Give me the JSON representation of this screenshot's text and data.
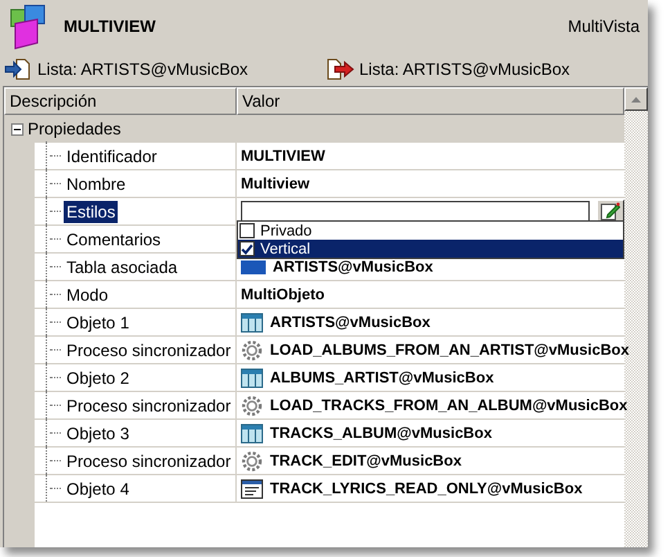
{
  "header": {
    "title": "MULTIVIEW",
    "type_label": "MultiVista"
  },
  "links": [
    {
      "kind": "in",
      "label": "Lista: ARTISTS@vMusicBox"
    },
    {
      "kind": "out",
      "label": "Lista: ARTISTS@vMusicBox"
    }
  ],
  "grid": {
    "columns": [
      "Descripción",
      "Valor"
    ],
    "group": {
      "label": "Propiedades",
      "expanded": true,
      "rows": [
        {
          "label": "Identificador",
          "kind": "text",
          "value": "MULTIVIEW",
          "selected": false
        },
        {
          "label": "Nombre",
          "kind": "text",
          "value": "Multiview",
          "selected": false
        },
        {
          "label": "Estilos",
          "kind": "edit",
          "value": "",
          "selected": true
        },
        {
          "label": "Comentarios",
          "kind": "text",
          "value": "",
          "selected": false
        },
        {
          "label": "Tabla asociada",
          "kind": "swatch",
          "value": "ARTISTS@vMusicBox",
          "selected": false
        },
        {
          "label": "Modo",
          "kind": "text",
          "value": "MultiObjeto",
          "selected": false
        },
        {
          "label": "Objeto 1",
          "kind": "table",
          "value": "ARTISTS@vMusicBox",
          "selected": false
        },
        {
          "label": "Proceso sincronizador",
          "kind": "gear",
          "value": "LOAD_ALBUMS_FROM_AN_ARTIST@vMusicBox",
          "selected": false
        },
        {
          "label": "Objeto 2",
          "kind": "table",
          "value": "ALBUMS_ARTIST@vMusicBox",
          "selected": false
        },
        {
          "label": "Proceso sincronizador",
          "kind": "gear",
          "value": "LOAD_TRACKS_FROM_AN_ALBUM@vMusicBox",
          "selected": false
        },
        {
          "label": "Objeto 3",
          "kind": "table",
          "value": "TRACKS_ALBUM@vMusicBox",
          "selected": false
        },
        {
          "label": "Proceso sincronizador",
          "kind": "gear",
          "value": "TRACK_EDIT@vMusicBox",
          "selected": false
        },
        {
          "label": "Objeto 4",
          "kind": "form",
          "value": "TRACK_LYRICS_READ_ONLY@vMusicBox",
          "selected": false
        }
      ]
    }
  },
  "dropdown": {
    "options": [
      {
        "label": "Privado",
        "checked": false,
        "selected": false
      },
      {
        "label": "Vertical",
        "checked": true,
        "selected": true
      }
    ]
  }
}
